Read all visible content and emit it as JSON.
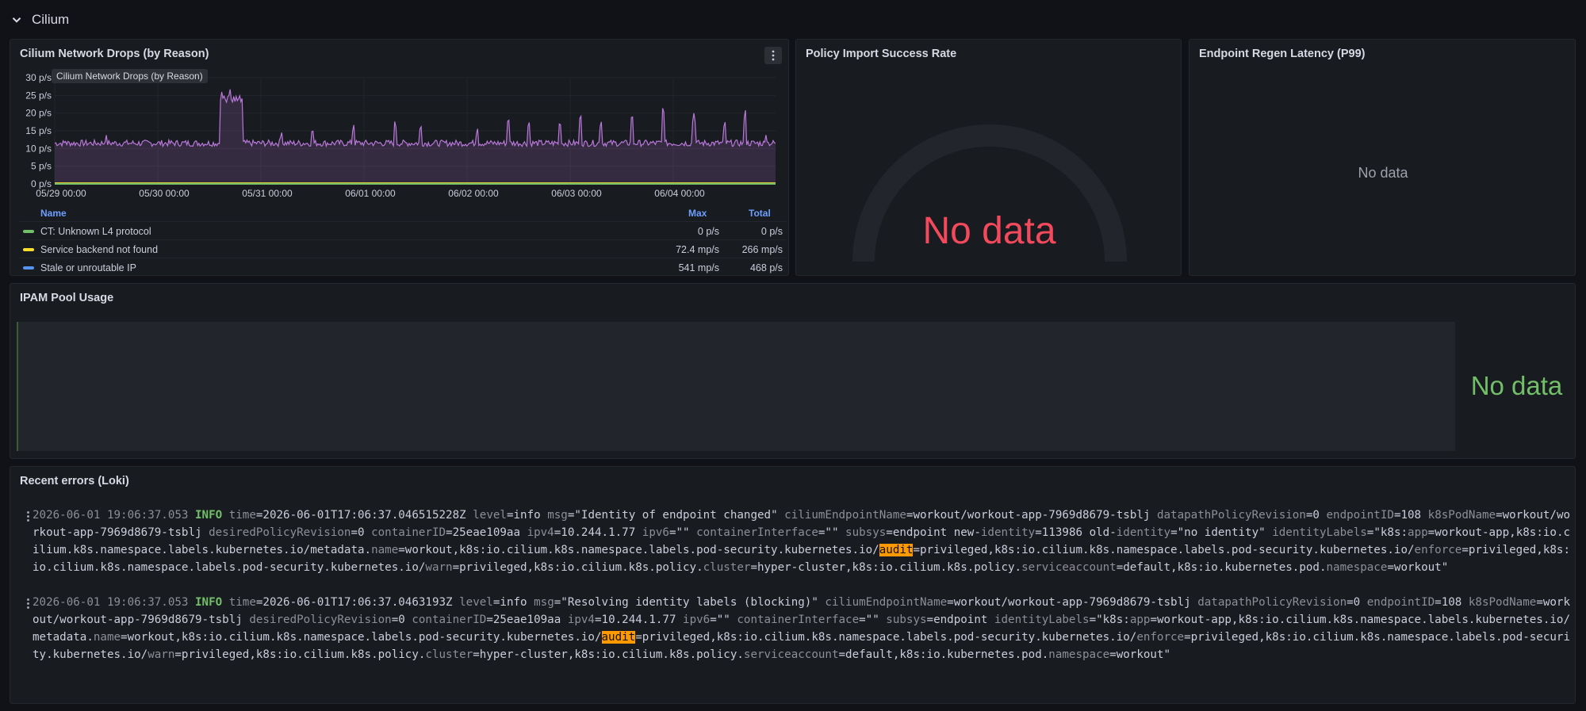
{
  "row": {
    "title": "Cilium"
  },
  "panels": {
    "drops": {
      "title": "Cilium Network Drops (by Reason)",
      "tooltip": "Cilium Network Drops (by Reason)",
      "legend_headers": {
        "name": "Name",
        "max": "Max",
        "total": "Total"
      },
      "legend": [
        {
          "name": "CT: Unknown L4 protocol",
          "max": "0 p/s",
          "total": "0 p/s",
          "color": "#73bf69"
        },
        {
          "name": "Service backend not found",
          "max": "72.4 mp/s",
          "total": "266 mp/s",
          "color": "#fade2a"
        },
        {
          "name": "Stale or unroutable IP",
          "max": "541 mp/s",
          "total": "468 p/s",
          "color": "#5794f2"
        }
      ]
    },
    "policy": {
      "title": "Policy Import Success Rate",
      "nodata": "No data"
    },
    "endpoint": {
      "title": "Endpoint Regen Latency (P99)",
      "nodata": "No data"
    },
    "ipam": {
      "title": "IPAM Pool Usage",
      "nodata": "No data"
    },
    "loki": {
      "title": "Recent errors (Loki)"
    }
  },
  "chart_data": {
    "type": "line",
    "y_tick_labels": [
      "0 p/s",
      "5 p/s",
      "10 p/s",
      "15 p/s",
      "20 p/s",
      "25 p/s",
      "30 p/s"
    ],
    "x_tick_labels": [
      "05/29 00:00",
      "05/30 00:00",
      "05/31 00:00",
      "06/01 00:00",
      "06/02 00:00",
      "06/03 00:00",
      "06/04 00:00"
    ],
    "ylim": [
      0,
      30
    ],
    "grid": true,
    "legend_position": "bottom",
    "series": [
      {
        "name": "Stale or unroutable IP",
        "color": "#b877d9",
        "baseline": 11.5,
        "spikes": [
          [
            0.1,
            13
          ],
          [
            0.5,
            14
          ],
          [
            1.62,
            26
          ],
          [
            1.7,
            27
          ],
          [
            2.2,
            15
          ],
          [
            2.5,
            16
          ],
          [
            2.9,
            17
          ],
          [
            3.3,
            18
          ],
          [
            3.55,
            17
          ],
          [
            4.1,
            16
          ],
          [
            4.4,
            19
          ],
          [
            4.6,
            18
          ],
          [
            4.9,
            18
          ],
          [
            5.1,
            20
          ],
          [
            5.3,
            18
          ],
          [
            5.6,
            20
          ],
          [
            5.9,
            22
          ],
          [
            6.2,
            20
          ],
          [
            6.5,
            18
          ],
          [
            6.7,
            21
          ],
          [
            6.9,
            14
          ]
        ]
      },
      {
        "name": "Service backend not found",
        "color": "#fade2a",
        "constant": 0.2
      },
      {
        "name": "CT: Unknown L4 protocol",
        "color": "#73bf69",
        "constant": 0
      }
    ]
  },
  "logs": [
    {
      "ts": "2026-06-01 19:06:37.053",
      "level": "INFO",
      "parts": [
        [
          "k",
          "time"
        ],
        [
          "v",
          "=2026-06-01T17:06:37.046515228Z "
        ],
        [
          "k",
          "level"
        ],
        [
          "v",
          "=info "
        ],
        [
          "k",
          "msg"
        ],
        [
          "v",
          "=\"Identity of endpoint changed\" "
        ],
        [
          "k",
          "ciliumEndpointName"
        ],
        [
          "v",
          "=workout/workout-app-7969d8679-tsblj "
        ],
        [
          "k",
          "datapathPolicyRevision"
        ],
        [
          "v",
          "=0 "
        ],
        [
          "k",
          "endpointID"
        ],
        [
          "v",
          "=108 "
        ],
        [
          "k",
          "k8sPodName"
        ],
        [
          "v",
          "=workout/workout-app-7969d8679-tsblj "
        ],
        [
          "k",
          "desiredPolicyRevision"
        ],
        [
          "v",
          "=0 "
        ],
        [
          "k",
          "containerID"
        ],
        [
          "v",
          "=25eae109aa "
        ],
        [
          "k",
          "ipv4"
        ],
        [
          "v",
          "=10.244.1.77 "
        ],
        [
          "k",
          "ipv6"
        ],
        [
          "v",
          "=\"\" "
        ],
        [
          "k",
          "containerInterface"
        ],
        [
          "v",
          "=\"\" "
        ],
        [
          "k",
          "subsys"
        ],
        [
          "v",
          "=endpoint new-"
        ],
        [
          "k",
          "identity"
        ],
        [
          "v",
          "=113986 old-"
        ],
        [
          "k",
          "identity"
        ],
        [
          "v",
          "=\"no identity\" "
        ],
        [
          "k",
          "identityLabels"
        ],
        [
          "v",
          "=\"k8s:"
        ],
        [
          "k",
          "app"
        ],
        [
          "v",
          "=workout-app,k8s:io.cilium.k8s.namespace.labels.kubernetes.io/metadata."
        ],
        [
          "k",
          "name"
        ],
        [
          "v",
          "=workout,k8s:io.cilium.k8s.namespace.labels.pod-security.kubernetes.io/"
        ],
        [
          "h",
          "audit"
        ],
        [
          "v",
          "=privileged,k8s:io.cilium.k8s.namespace.labels.pod-security.kubernetes.io/"
        ],
        [
          "k",
          "enforce"
        ],
        [
          "v",
          "=privileged,k8s:io.cilium.k8s.namespace.labels.pod-security.kubernetes.io/"
        ],
        [
          "k",
          "warn"
        ],
        [
          "v",
          "=privileged,k8s:io.cilium.k8s.policy."
        ],
        [
          "k",
          "cluster"
        ],
        [
          "v",
          "=hyper-cluster,k8s:io.cilium.k8s.policy."
        ],
        [
          "k",
          "serviceaccount"
        ],
        [
          "v",
          "=default,k8s:io.kubernetes.pod."
        ],
        [
          "k",
          "namespace"
        ],
        [
          "v",
          "=workout\""
        ]
      ]
    },
    {
      "ts": "2026-06-01 19:06:37.053",
      "level": "INFO",
      "parts": [
        [
          "k",
          "time"
        ],
        [
          "v",
          "=2026-06-01T17:06:37.0463193Z "
        ],
        [
          "k",
          "level"
        ],
        [
          "v",
          "=info "
        ],
        [
          "k",
          "msg"
        ],
        [
          "v",
          "=\"Resolving identity labels (blocking)\" "
        ],
        [
          "k",
          "ciliumEndpointName"
        ],
        [
          "v",
          "=workout/workout-app-7969d8679-tsblj "
        ],
        [
          "k",
          "datapathPolicyRevision"
        ],
        [
          "v",
          "=0 "
        ],
        [
          "k",
          "endpointID"
        ],
        [
          "v",
          "=108 "
        ],
        [
          "k",
          "k8sPodName"
        ],
        [
          "v",
          "=workout/workout-app-7969d8679-tsblj "
        ],
        [
          "k",
          "desiredPolicyRevision"
        ],
        [
          "v",
          "=0 "
        ],
        [
          "k",
          "containerID"
        ],
        [
          "v",
          "=25eae109aa "
        ],
        [
          "k",
          "ipv4"
        ],
        [
          "v",
          "=10.244.1.77 "
        ],
        [
          "k",
          "ipv6"
        ],
        [
          "v",
          "=\"\" "
        ],
        [
          "k",
          "containerInterface"
        ],
        [
          "v",
          "=\"\" "
        ],
        [
          "k",
          "subsys"
        ],
        [
          "v",
          "=endpoint "
        ],
        [
          "k",
          "identityLabels"
        ],
        [
          "v",
          "=\"k8s:"
        ],
        [
          "k",
          "app"
        ],
        [
          "v",
          "=workout-app,k8s:io.cilium.k8s.namespace.labels.kubernetes.io/metadata."
        ],
        [
          "k",
          "name"
        ],
        [
          "v",
          "=workout,k8s:io.cilium.k8s.namespace.labels.pod-security.kubernetes.io/"
        ],
        [
          "h",
          "audit"
        ],
        [
          "v",
          "=privileged,k8s:io.cilium.k8s.namespace.labels.pod-security.kubernetes.io/"
        ],
        [
          "k",
          "enforce"
        ],
        [
          "v",
          "=privileged,k8s:io.cilium.k8s.namespace.labels.pod-security.kubernetes.io/"
        ],
        [
          "k",
          "warn"
        ],
        [
          "v",
          "=privileged,k8s:io.cilium.k8s.policy."
        ],
        [
          "k",
          "cluster"
        ],
        [
          "v",
          "=hyper-cluster,k8s:io.cilium.k8s.policy."
        ],
        [
          "k",
          "serviceaccount"
        ],
        [
          "v",
          "=default,k8s:io.kubernetes.pod."
        ],
        [
          "k",
          "namespace"
        ],
        [
          "v",
          "=workout\""
        ]
      ]
    }
  ],
  "colors": {
    "nodata_red": "#f2495c",
    "nodata_green": "#73bf69",
    "accent_blue": "#6e9fff",
    "highlight": "#ff9900"
  }
}
